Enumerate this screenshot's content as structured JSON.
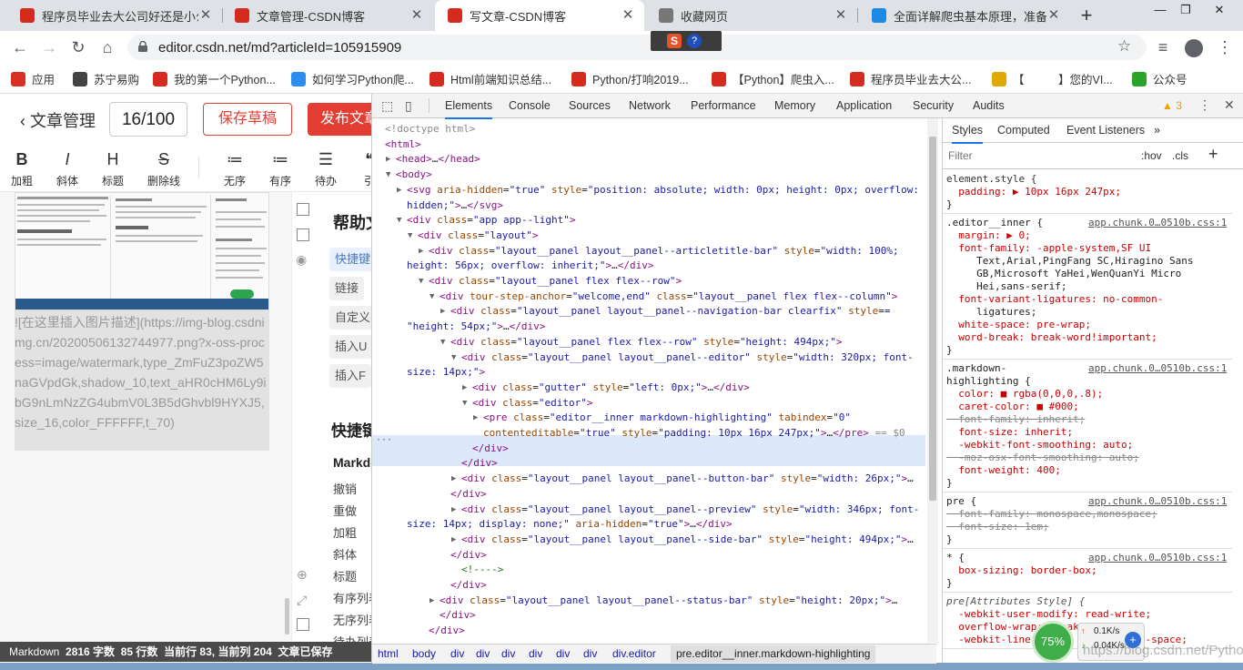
{
  "browser": {
    "tabs": [
      {
        "title": "程序员毕业去大公司好还是小公司",
        "favicon_color": "#d52b1e",
        "active": false
      },
      {
        "title": "文章管理-CSDN博客",
        "favicon_color": "#d52b1e",
        "active": false
      },
      {
        "title": "写文章-CSDN博客",
        "favicon_color": "#d52b1e",
        "active": true
      },
      {
        "title": "收藏网页",
        "favicon_color": "#777777",
        "active": false
      },
      {
        "title": "全面详解爬虫基本原理，准备爬",
        "favicon_color": "#1e88e5",
        "active": false
      }
    ],
    "new_tab_label": "+",
    "url": "editor.csdn.net/md?articleId=105915909",
    "bookmarks": [
      {
        "label": "应用",
        "color": "#d93025"
      },
      {
        "label": "苏宁易购",
        "color": "#444444"
      },
      {
        "label": "我的第一个Python...",
        "color": "#d52b1e"
      },
      {
        "label": "如何学习Python爬...",
        "color": "#2d8cf0"
      },
      {
        "label": "Html前端知识总结...",
        "color": "#d52b1e"
      },
      {
        "label": "Python/打响2019...",
        "color": "#d52b1e"
      },
      {
        "label": "【Python】爬虫入...",
        "color": "#d52b1e"
      },
      {
        "label": "程序员毕业去大公...",
        "color": "#d52b1e"
      },
      {
        "label": "【　　　】您的VI...",
        "color": "#e0a800"
      },
      {
        "label": "公众号",
        "color": "#2aa52a"
      }
    ]
  },
  "app": {
    "back_label": "文章管理",
    "title_counter": "16/100",
    "save_draft": "保存草稿",
    "publish": "发布文章",
    "toolbar": [
      {
        "icon": "B",
        "label": "加粗"
      },
      {
        "icon": "I",
        "label": "斜体"
      },
      {
        "icon": "H",
        "label": "标题"
      },
      {
        "icon": "S",
        "label": "删除线"
      },
      {
        "icon": "≔",
        "label": "无序"
      },
      {
        "icon": "≔",
        "label": "有序"
      },
      {
        "icon": "☰",
        "label": "待办"
      },
      {
        "icon": "❝",
        "label": "引"
      }
    ],
    "editor_image_text": "![在这里插入图片描述](https://img-blog.csdnimg.cn/20200506132744977.png?x-oss-process=image/watermark,type_ZmFuZ3poZW5naGVpdGk,shadow_10,text_aHR0cHM6Ly9ibG9nLmNzZG4ubmV0L3B5dGhvbl9HYXJ5,size_16,color_FFFFFF,t_70)",
    "help": {
      "title": "帮助文档",
      "chips": [
        "快捷键",
        "链接",
        "自定义",
        "插入U",
        "插入F"
      ],
      "shortcut_title": "快捷键",
      "markdown_title": "Markdown",
      "shortcuts": [
        "撤销",
        "重做",
        "加粗",
        "斜体",
        "标题",
        "有序列表",
        "无序列表",
        "待办列表"
      ]
    },
    "status": {
      "mode": "Markdown",
      "words": "2816 字数",
      "lines": "85 行数",
      "current_line": "当前行 83,",
      "current_col": "当前列 204",
      "saved": "文章已保存"
    }
  },
  "devtools": {
    "tabs": [
      "Elements",
      "Console",
      "Sources",
      "Network",
      "Performance",
      "Memory",
      "Application",
      "Security",
      "Audits"
    ],
    "warnings": "3",
    "dom_lines": [
      {
        "indent": 0,
        "tri": "",
        "html": "<span class='gy'>&lt;!doctype html&gt;</span>"
      },
      {
        "indent": 0,
        "tri": "",
        "html": "<span class='tg'>&lt;html&gt;</span>"
      },
      {
        "indent": 1,
        "tri": "▶",
        "html": "<span class='tg'>&lt;head&gt;</span>…<span class='tg'>&lt;/head&gt;</span>"
      },
      {
        "indent": 1,
        "tri": "▼",
        "html": "<span class='tg'>&lt;body&gt;</span>"
      },
      {
        "indent": 2,
        "tri": "▶",
        "html": "<span class='tg'>&lt;svg </span><span class='an'>aria-hidden</span>=<span class='av'>\"true\"</span> <span class='an'>style</span>=<span class='av'>\"position: absolute; width: 0px; height: 0px; overflow:</span>"
      },
      {
        "indent": 2,
        "tri": "",
        "html": "<span class='av'>hidden;\"</span><span class='tg'>&gt;</span>…<span class='tg'>&lt;/svg&gt;</span>",
        "cont": true
      },
      {
        "indent": 2,
        "tri": "▼",
        "html": "<span class='tg'>&lt;div </span><span class='an'>class</span>=<span class='av'>\"app app--light\"</span><span class='tg'>&gt;</span>"
      },
      {
        "indent": 3,
        "tri": "▼",
        "html": "<span class='tg'>&lt;div </span><span class='an'>class</span>=<span class='av'>\"layout\"</span><span class='tg'>&gt;</span>"
      },
      {
        "indent": 4,
        "tri": "▶",
        "html": "<span class='tg'>&lt;div </span><span class='an'>class</span>=<span class='av'>\"layout__panel layout__panel--articletitle-bar\"</span> <span class='an'>style</span>=<span class='av'>\"width: 100%;</span>"
      },
      {
        "indent": 2,
        "tri": "",
        "html": "<span class='av'>height: 56px; overflow: inherit;\"</span><span class='tg'>&gt;</span>…<span class='tg'>&lt;/div&gt;</span>",
        "cont": true
      },
      {
        "indent": 4,
        "tri": "▼",
        "html": "<span class='tg'>&lt;div </span><span class='an'>class</span>=<span class='av'>\"layout__panel flex flex--row\"</span><span class='tg'>&gt;</span>"
      },
      {
        "indent": 5,
        "tri": "▼",
        "html": "<span class='tg'>&lt;div </span><span class='an'>tour-step-anchor</span>=<span class='av'>\"welcome,end\"</span> <span class='an'>class</span>=<span class='av'>\"layout__panel flex flex--column\"</span><span class='tg'>&gt;</span>"
      },
      {
        "indent": 6,
        "tri": "▶",
        "html": "<span class='tg'>&lt;div </span><span class='an'>class</span>=<span class='av'>\"layout__panel layout__panel--navigation-bar clearfix\"</span> <span class='an'>style</span>=<span class='av'>=</span>"
      },
      {
        "indent": 2,
        "tri": "",
        "html": "<span class='av'>\"height: 54px;\"</span><span class='tg'>&gt;</span>…<span class='tg'>&lt;/div&gt;</span>",
        "cont": true
      },
      {
        "indent": 6,
        "tri": "▼",
        "html": "<span class='tg'>&lt;div </span><span class='an'>class</span>=<span class='av'>\"layout__panel flex flex--row\"</span> <span class='an'>style</span>=<span class='av'>\"height: 494px;\"</span><span class='tg'>&gt;</span>"
      },
      {
        "indent": 7,
        "tri": "▼",
        "html": "<span class='tg'>&lt;div </span><span class='an'>class</span>=<span class='av'>\"layout__panel layout__panel--editor\"</span> <span class='an'>style</span>=<span class='av'>\"width: 320px; font-</span>"
      },
      {
        "indent": 2,
        "tri": "",
        "html": "<span class='av'>size: 14px;\"</span><span class='tg'>&gt;</span>",
        "cont": true
      },
      {
        "indent": 8,
        "tri": "▶",
        "html": "<span class='tg'>&lt;div </span><span class='an'>class</span>=<span class='av'>\"gutter\"</span> <span class='an'>style</span>=<span class='av'>\"left: 0px;\"</span><span class='tg'>&gt;</span>…<span class='tg'>&lt;/div&gt;</span>"
      },
      {
        "indent": 8,
        "tri": "▼",
        "html": "<span class='tg'>&lt;div </span><span class='an'>class</span>=<span class='av'>\"editor\"</span><span class='tg'>&gt;</span>"
      },
      {
        "indent": 9,
        "tri": "▶",
        "html": "<span class='tg'>&lt;pre </span><span class='an'>class</span>=<span class='av'>\"editor__inner markdown-highlighting\"</span> <span class='an'>tabindex</span>=<span class='av'>\"0\"</span>"
      },
      {
        "indent": 9,
        "tri": "",
        "html": "<span class='an'>contenteditable</span>=<span class='av'>\"true\"</span> <span class='an'>style</span>=<span class='av'>\"padding: 10px 16px 247px;\"</span><span class='tg'>&gt;</span>…<span class='tg'>&lt;/pre&gt;</span> <span class='gy'>== $0</span>",
        "cont": true
      },
      {
        "indent": 8,
        "tri": "",
        "html": "<span class='tg'>&lt;/div&gt;</span>"
      },
      {
        "indent": 7,
        "tri": "",
        "html": "<span class='tg'>&lt;/div&gt;</span>"
      },
      {
        "indent": 7,
        "tri": "▶",
        "html": "<span class='tg'>&lt;div </span><span class='an'>class</span>=<span class='av'>\"layout__panel layout__panel--button-bar\"</span> <span class='an'>style</span>=<span class='av'>\"width: 26px;\"</span><span class='tg'>&gt;</span>…"
      },
      {
        "indent": 6,
        "tri": "",
        "html": "<span class='tg'>&lt;/div&gt;</span>"
      },
      {
        "indent": 7,
        "tri": "▶",
        "html": "<span class='tg'>&lt;div </span><span class='an'>class</span>=<span class='av'>\"layout__panel layout__panel--preview\"</span> <span class='an'>style</span>=<span class='av'>\"width: 346px; font-</span>"
      },
      {
        "indent": 2,
        "tri": "",
        "html": "<span class='av'>size: 14px; display: none;\"</span> <span class='an'>aria-hidden</span>=<span class='av'>\"true\"</span><span class='tg'>&gt;</span>…<span class='tg'>&lt;/div&gt;</span>",
        "cont": true
      },
      {
        "indent": 7,
        "tri": "▶",
        "html": "<span class='tg'>&lt;div </span><span class='an'>class</span>=<span class='av'>\"layout__panel layout__panel--side-bar\"</span> <span class='an'>style</span>=<span class='av'>\"height: 494px;\"</span><span class='tg'>&gt;</span>…"
      },
      {
        "indent": 6,
        "tri": "",
        "html": "<span class='tg'>&lt;/div&gt;</span>"
      },
      {
        "indent": 7,
        "tri": "",
        "html": "<span class='cm'>&lt;!----&gt;</span>"
      },
      {
        "indent": 6,
        "tri": "",
        "html": "<span class='tg'>&lt;/div&gt;</span>"
      },
      {
        "indent": 5,
        "tri": "▶",
        "html": "<span class='tg'>&lt;div </span><span class='an'>class</span>=<span class='av'>\"layout__panel layout__panel--status-bar\"</span> <span class='an'>style</span>=<span class='av'>\"height: 20px;\"</span><span class='tg'>&gt;</span>…"
      },
      {
        "indent": 5,
        "tri": "",
        "html": "<span class='tg'>&lt;/div&gt;</span>"
      },
      {
        "indent": 4,
        "tri": "",
        "html": "<span class='tg'>&lt;/div&gt;</span>"
      }
    ],
    "breadcrumbs": [
      "html",
      "body",
      "div",
      "div",
      "div",
      "div",
      "div",
      "div",
      "div.editor",
      "pre.editor__inner.markdown-highlighting"
    ],
    "styles_tabs": [
      "Styles",
      "Computed",
      "Event Listeners",
      "»"
    ],
    "filter_placeholder": "Filter",
    "hov": ":hov",
    "cls": ".cls",
    "rules": [
      {
        "lines": [
          {
            "t": "element.style {",
            "k": "sel"
          },
          {
            "t": "  padding: ▶ 10px 16px 247px;",
            "k": "prop"
          },
          {
            "t": "}",
            "k": "plain"
          }
        ]
      },
      {
        "source": "app.chunk.0…0510b.css:1",
        "lines": [
          {
            "t": ".editor__inner {",
            "k": "sel"
          },
          {
            "t": "  margin: ▶ 0;",
            "k": "prop"
          },
          {
            "t": "  font-family: -apple-system,SF UI",
            "k": "prop"
          },
          {
            "t": "     Text,Arial,PingFang SC,Hiragino Sans",
            "k": "plain"
          },
          {
            "t": "     GB,Microsoft YaHei,WenQuanYi Micro",
            "k": "plain"
          },
          {
            "t": "     Hei,sans-serif;",
            "k": "plain"
          },
          {
            "t": "  font-variant-ligatures: no-common-",
            "k": "prop"
          },
          {
            "t": "     ligatures;",
            "k": "plain"
          },
          {
            "t": "  white-space: pre-wrap;",
            "k": "prop"
          },
          {
            "t": "  word-break: break-word!important;",
            "k": "prop"
          },
          {
            "t": "}",
            "k": "plain"
          }
        ]
      },
      {
        "source": "app.chunk.0…0510b.css:1",
        "lines": [
          {
            "t": ".markdown-",
            "k": "sel"
          },
          {
            "t": "highlighting {",
            "k": "sel"
          },
          {
            "t": "  color: ■ rgba(0,0,0,.8);",
            "k": "prop"
          },
          {
            "t": "  caret-color: ■ #000;",
            "k": "prop"
          },
          {
            "t": "  font-family: inherit;",
            "k": "strike"
          },
          {
            "t": "  font-size: inherit;",
            "k": "prop"
          },
          {
            "t": "  -webkit-font-smoothing: auto;",
            "k": "prop"
          },
          {
            "t": "  -moz-osx-font-smoothing: auto;",
            "k": "strike"
          },
          {
            "t": "  font-weight: 400;",
            "k": "prop"
          },
          {
            "t": "}",
            "k": "plain"
          }
        ]
      },
      {
        "source": "app.chunk.0…0510b.css:1",
        "lines": [
          {
            "t": "pre {",
            "k": "sel"
          },
          {
            "t": "  font-family: monospace,monospace;",
            "k": "strike"
          },
          {
            "t": "  font-size: 1em;",
            "k": "strike"
          },
          {
            "t": "}",
            "k": "plain"
          }
        ]
      },
      {
        "source": "app.chunk.0…0510b.css:1",
        "lines": [
          {
            "t": "* {",
            "k": "sel"
          },
          {
            "t": "  box-sizing: border-box;",
            "k": "prop"
          },
          {
            "t": "}",
            "k": "plain"
          }
        ]
      },
      {
        "lines": [
          {
            "t": "pre[Attributes Style] {",
            "k": "selit"
          },
          {
            "t": "  -webkit-user-modify: read-write;",
            "k": "prop"
          },
          {
            "t": "  overflow-wrap: break-word;",
            "k": "prop"
          },
          {
            "t": "  -webkit-line-break: after-white-space;",
            "k": "prop"
          }
        ]
      }
    ]
  },
  "net_widget": {
    "percent": "75%",
    "up": "0.1K/s",
    "down": "0.04K/s"
  },
  "watermark": "https://blog.csdn.net/Python_Gary"
}
